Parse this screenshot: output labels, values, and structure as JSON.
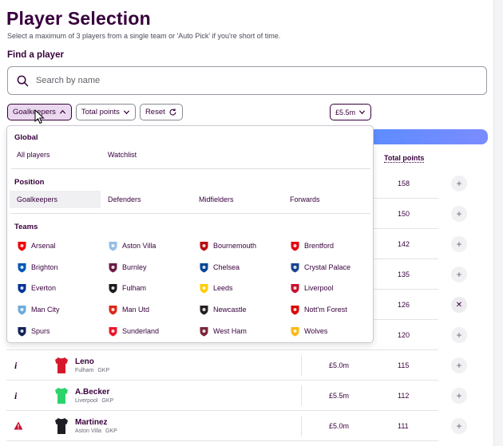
{
  "header": {
    "title": "Player Selection",
    "subtitle": "Select a maximum of 3 players from a single team or 'Auto Pick' if you're short of time."
  },
  "search": {
    "label": "Find a player",
    "placeholder": "Search by name"
  },
  "filters": {
    "position": "Goalkeepers",
    "sort": "Total points",
    "price": "£5.5m",
    "reset": "Reset"
  },
  "table": {
    "points_header": "Total points",
    "rows": [
      {
        "points": "158",
        "action": "add"
      },
      {
        "points": "150",
        "action": "add"
      },
      {
        "points": "142",
        "action": "add"
      },
      {
        "points": "135",
        "action": "add"
      },
      {
        "points": "126",
        "action": "remove"
      },
      {
        "points": "120",
        "action": "add"
      },
      {
        "name": "Leno",
        "team": "Fulham",
        "position": "GKP",
        "price": "£5.0m",
        "points": "115",
        "status": "info",
        "shirt_color": "#d7182a",
        "action": "add"
      },
      {
        "name": "A.Becker",
        "team": "Liverpool",
        "position": "GKP",
        "price": "£5.5m",
        "points": "112",
        "status": "info",
        "shirt_color": "#2bd46b",
        "action": "add"
      },
      {
        "name": "Martinez",
        "team": "Aston Villa",
        "position": "GKP",
        "price": "£5.0m",
        "points": "111",
        "status": "warning",
        "shirt_color": "#1e1e24",
        "action": "add"
      }
    ]
  },
  "dropdown": {
    "global_heading": "Global",
    "global_items": [
      "All players",
      "Watchlist"
    ],
    "position_heading": "Position",
    "positions": [
      "Goalkeepers",
      "Defenders",
      "Midfielders",
      "Forwards"
    ],
    "selected_position": "Goalkeepers",
    "teams_heading": "Teams",
    "teams": [
      {
        "name": "Arsenal",
        "color": "#ef0107"
      },
      {
        "name": "Aston Villa",
        "color": "#95bfe5"
      },
      {
        "name": "Bournemouth",
        "color": "#b50e12"
      },
      {
        "name": "Brentford",
        "color": "#e30613"
      },
      {
        "name": "Brighton",
        "color": "#0057b8"
      },
      {
        "name": "Burnley",
        "color": "#6c1d45"
      },
      {
        "name": "Chelsea",
        "color": "#034694"
      },
      {
        "name": "Crystal Palace",
        "color": "#1b458f"
      },
      {
        "name": "Everton",
        "color": "#003399"
      },
      {
        "name": "Fulham",
        "color": "#1a1a1a"
      },
      {
        "name": "Leeds",
        "color": "#ffcd00"
      },
      {
        "name": "Liverpool",
        "color": "#c8102e"
      },
      {
        "name": "Man City",
        "color": "#6cabdd"
      },
      {
        "name": "Man Utd",
        "color": "#da291c"
      },
      {
        "name": "Newcastle",
        "color": "#241f20"
      },
      {
        "name": "Nott'm Forest",
        "color": "#dd0000"
      },
      {
        "name": "Spurs",
        "color": "#132257"
      },
      {
        "name": "Sunderland",
        "color": "#eb172b"
      },
      {
        "name": "West Ham",
        "color": "#7a263a"
      },
      {
        "name": "Wolves",
        "color": "#fdb913"
      }
    ]
  },
  "colors": {
    "brand": "#37003c",
    "banner": "#6a8cff",
    "warning": "#c8102e"
  }
}
